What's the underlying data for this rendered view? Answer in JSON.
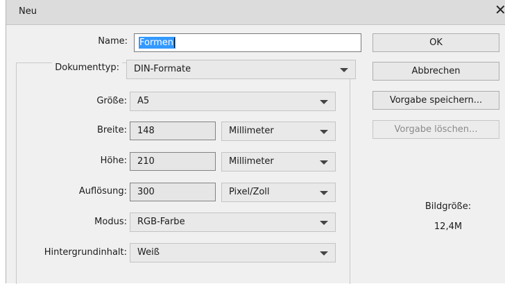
{
  "dialog": {
    "title": "Neu",
    "close_glyph": "✕"
  },
  "name": {
    "label": "Name:",
    "value": "Formen"
  },
  "dokumenttyp": {
    "label": "Dokumenttyp:",
    "value": "DIN-Formate"
  },
  "groesse": {
    "label": "Größe:",
    "value": "A5"
  },
  "breite": {
    "label": "Breite:",
    "value": "148",
    "unit": "Millimeter"
  },
  "hoehe": {
    "label": "Höhe:",
    "value": "210",
    "unit": "Millimeter"
  },
  "aufloesung": {
    "label": "Auflösung:",
    "value": "300",
    "unit": "Pixel/Zoll"
  },
  "modus": {
    "label": "Modus:",
    "value": "RGB-Farbe"
  },
  "hintergrund": {
    "label": "Hintergrundinhalt:",
    "value": "Weiß"
  },
  "buttons": {
    "ok": "OK",
    "abbrechen": "Abbrechen",
    "vorgabe_speichern": "Vorgabe speichern...",
    "vorgabe_loeschen": "Vorgabe löschen..."
  },
  "bildgroesse": {
    "label": "Bildgröße:",
    "value": "12,4M"
  },
  "icons": {
    "close": "close-icon",
    "dropdown": "chevron-down-icon"
  }
}
